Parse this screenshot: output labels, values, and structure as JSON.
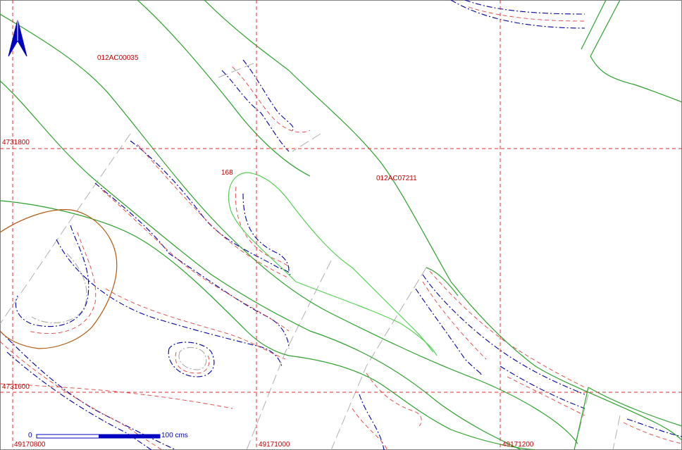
{
  "map": {
    "grid_labels": {
      "northing_top": "4731800",
      "northing_bottom": "4731600",
      "easting_left": "49170800",
      "easting_mid": "49171000",
      "easting_right": "49171200"
    },
    "parcel_labels": {
      "parcel_a": "012AC00035",
      "parcel_b": "012AC07211",
      "contour_value": "168"
    },
    "scale_bar": {
      "zero_label": "0",
      "end_label": "100 cms"
    },
    "north_arrow_icon": "north-arrow-icon",
    "colors": {
      "grid": "#e03030",
      "parcel_boundary": "#2ca02c",
      "contour_major": "#0000a0",
      "contour_minor": "#e04040",
      "highlight_polygon": "#b05a10",
      "selected_contour": "#55d055",
      "scale_bar": "#0000c0"
    }
  }
}
